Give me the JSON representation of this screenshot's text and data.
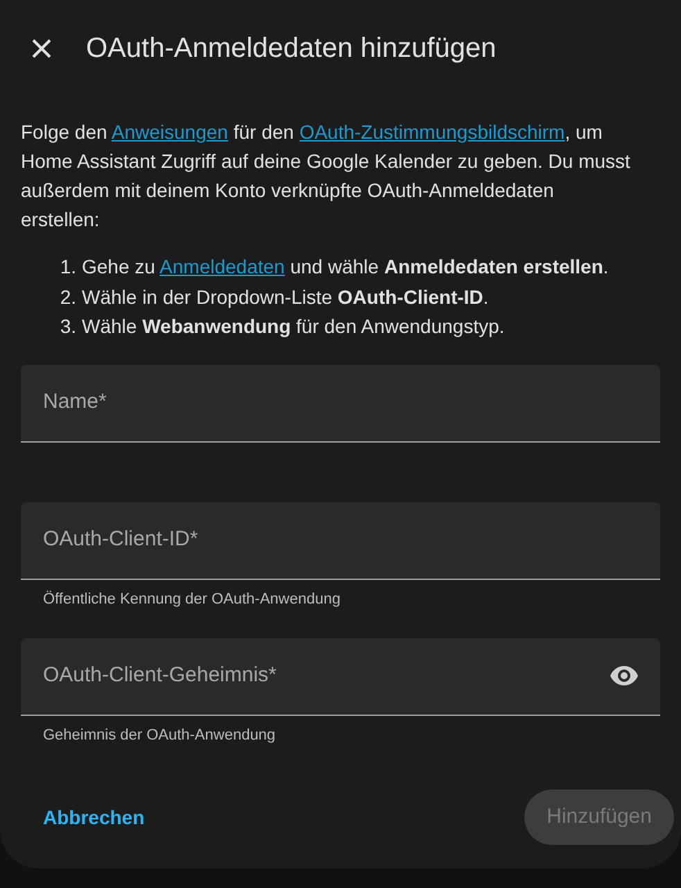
{
  "dialog": {
    "title": "OAuth-Anmeldedaten hinzufügen",
    "description": [
      {
        "kind": "text",
        "text": "Folge den "
      },
      {
        "kind": "link",
        "text": "Anweisungen"
      },
      {
        "kind": "text",
        "text": " für den "
      },
      {
        "kind": "link",
        "text": "OAuth-Zustimmungsbildschirm"
      },
      {
        "kind": "text",
        "text": ", um Home Assistant Zugriff auf deine Google Kalender zu geben. Du musst außerdem mit deinem Konto verknüpfte OAuth-Anmeldedaten erstellen:"
      }
    ],
    "steps": [
      {
        "number": "1.",
        "parts": [
          {
            "kind": "text",
            "text": "Gehe zu "
          },
          {
            "kind": "link",
            "text": "Anmeldedaten"
          },
          {
            "kind": "text",
            "text": " und wähle **Anmeldedaten erstellen**."
          }
        ]
      },
      {
        "number": "2.",
        "parts": [
          {
            "kind": "text",
            "text": "Wähle in der Dropdown-Liste **OAuth-Client-ID**."
          }
        ]
      },
      {
        "number": "3.",
        "parts": [
          {
            "kind": "text",
            "text": "Wähle **Webanwendung** für den Anwendungstyp."
          }
        ]
      }
    ],
    "fields": [
      {
        "label": "Name*",
        "kind": "text"
      },
      {
        "label": "OAuth-Client-ID*",
        "kind": "text",
        "helper": "Öffentliche Kennung der OAuth-Anwendung"
      },
      {
        "label": "OAuth-Client-Geheimnis*",
        "kind": "password",
        "helper": "Geheimnis der OAuth-Anwendung"
      }
    ],
    "cancel_button": {
      "label": "Abbrechen"
    },
    "submit_button": {
      "label": "Hinzufügen",
      "disabled": true
    }
  }
}
